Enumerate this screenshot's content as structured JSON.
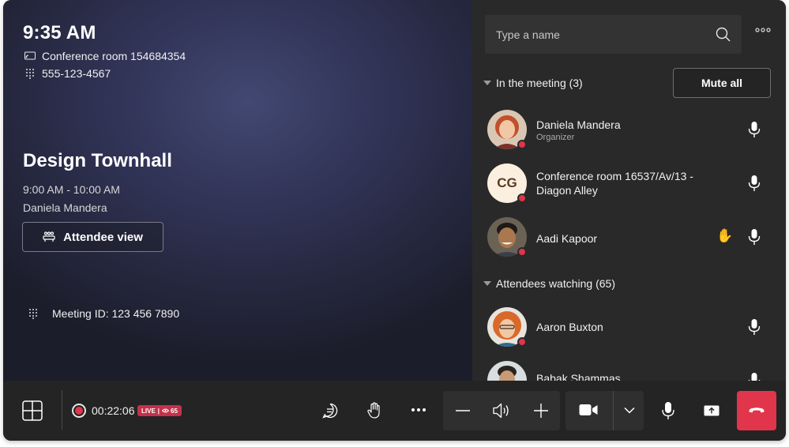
{
  "stage": {
    "clock": "9:35 AM",
    "room": "Conference room 154684354",
    "phone": "555-123-4567",
    "meeting_title": "Design Townhall",
    "time_range": "9:00 AM - 10:00 AM",
    "organizer": "Daniela Mandera",
    "attendee_view_label": "Attendee view",
    "meeting_id": "Meeting ID: 123 456 7890"
  },
  "panel": {
    "search_placeholder": "Type a name",
    "in_meeting_header": "In the meeting (3)",
    "mute_all_label": "Mute all",
    "attendees_header": "Attendees watching (65)",
    "participants": [
      {
        "name": "Daniela Mandera",
        "role": "Organizer"
      },
      {
        "name": "Conference room 16537/Av/13 - Diagon Alley",
        "initials": "CG"
      },
      {
        "name": "Aadi Kapoor",
        "hand": "✋"
      }
    ],
    "attendees": [
      {
        "name": "Aaron Buxton"
      },
      {
        "name": "Babak Shammas"
      }
    ]
  },
  "toolbar": {
    "timer": "00:22:06",
    "live_label": "LIVE",
    "viewer_count": "65"
  },
  "colors": {
    "accent_red": "#e0354a",
    "panel_bg": "#292929",
    "toolbar_bg": "#242424"
  },
  "icons": [
    "room-icon",
    "dialpad-icon",
    "attendee-view-icon",
    "search-icon",
    "more-icon",
    "mic-icon",
    "raised-hand-icon",
    "layout-icon",
    "record-icon",
    "chat-icon",
    "hand-icon",
    "volume-down-icon",
    "speaker-icon",
    "volume-up-icon",
    "camera-icon",
    "chevron-down-icon",
    "share-icon",
    "hang-up-icon"
  ]
}
